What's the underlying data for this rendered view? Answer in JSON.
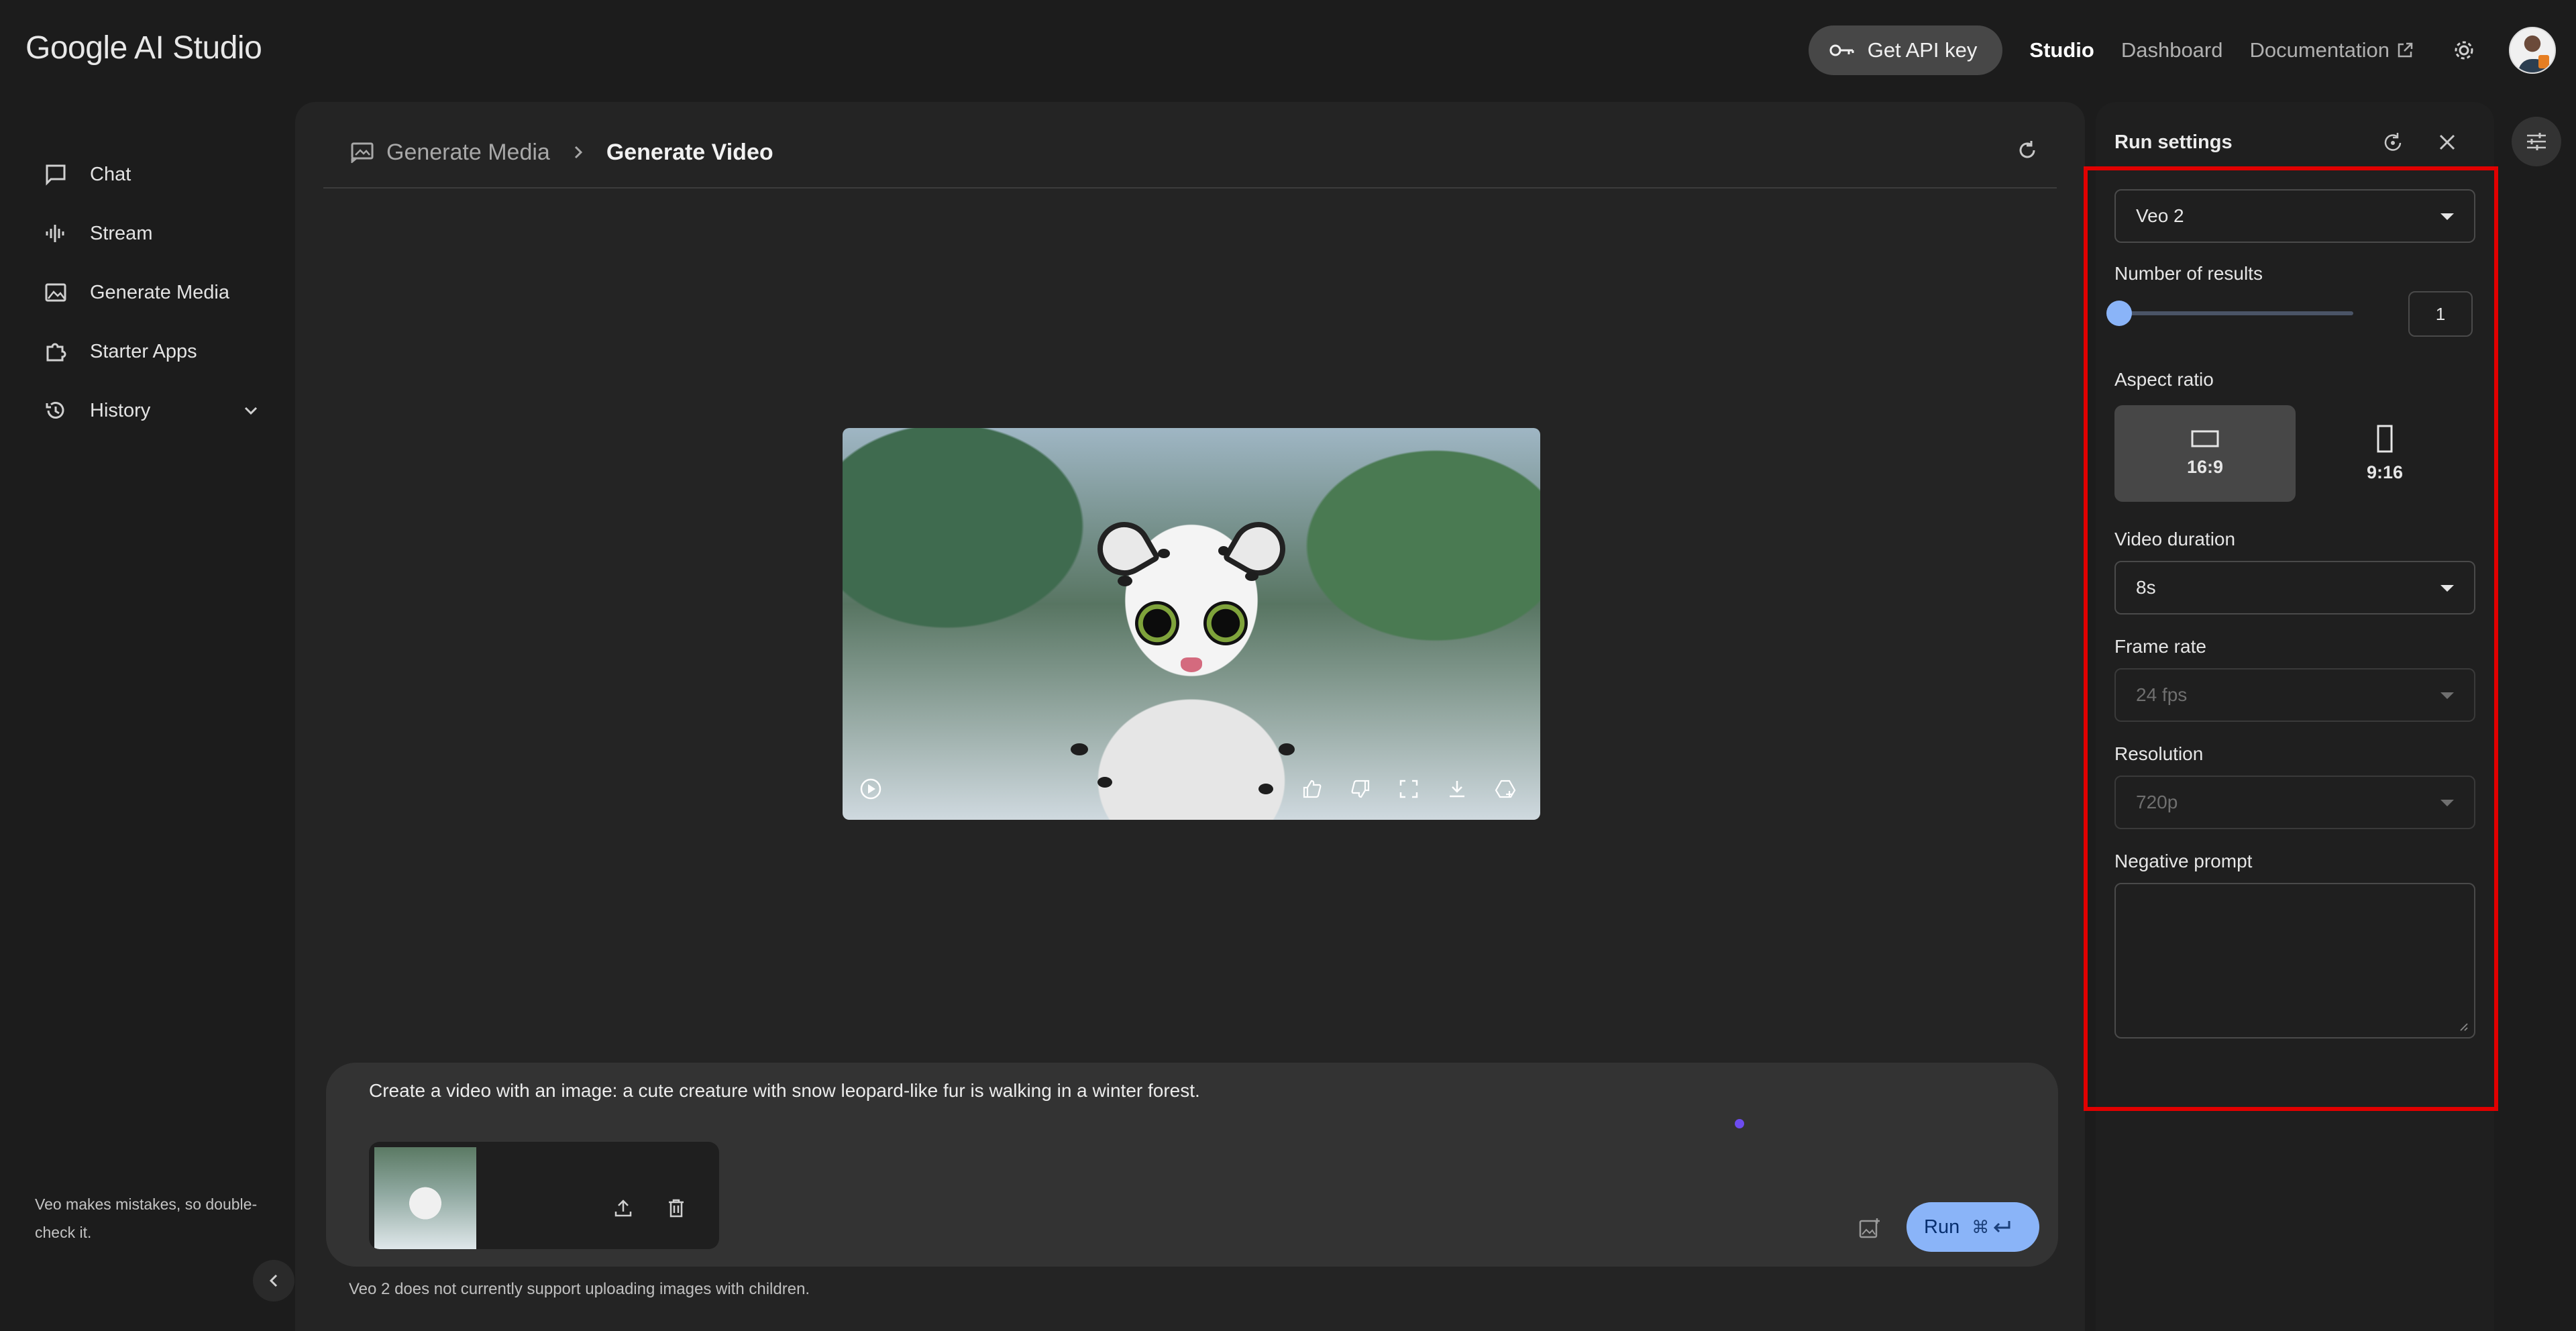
{
  "header": {
    "logo": "Google AI Studio",
    "api_key_label": "Get API key",
    "links": {
      "studio": "Studio",
      "dashboard": "Dashboard",
      "documentation": "Documentation"
    }
  },
  "sidebar": {
    "items": [
      {
        "label": "Chat",
        "icon": "chat-icon"
      },
      {
        "label": "Stream",
        "icon": "stream-icon"
      },
      {
        "label": "Generate Media",
        "icon": "image-icon"
      },
      {
        "label": "Starter Apps",
        "icon": "puzzle-icon"
      },
      {
        "label": "History",
        "icon": "history-icon"
      }
    ],
    "note": "Veo makes mistakes, so double-check it."
  },
  "main": {
    "breadcrumb": {
      "parent": "Generate Media",
      "current": "Generate Video"
    },
    "prompt": "Create a video with an image: a cute creature with snow leopard-like fur is walking in a winter forest.",
    "run_label": "Run",
    "run_shortcut": "⌘",
    "disclaimer": "Veo 2 does not currently support uploading images with children."
  },
  "run_settings": {
    "title": "Run settings",
    "model": "Veo 2",
    "number_of_results_label": "Number of results",
    "number_of_results": "1",
    "aspect_ratio_label": "Aspect ratio",
    "aspect_ratios": [
      "16:9",
      "9:16"
    ],
    "selected_aspect": "16:9",
    "video_duration_label": "Video duration",
    "video_duration": "8s",
    "frame_rate_label": "Frame rate",
    "frame_rate": "24 fps",
    "resolution_label": "Resolution",
    "resolution": "720p",
    "negative_prompt_label": "Negative prompt",
    "negative_prompt": ""
  },
  "colors": {
    "accent": "#8ab4f8",
    "highlight_box": "#e10000",
    "background": "#1c1c1c"
  }
}
